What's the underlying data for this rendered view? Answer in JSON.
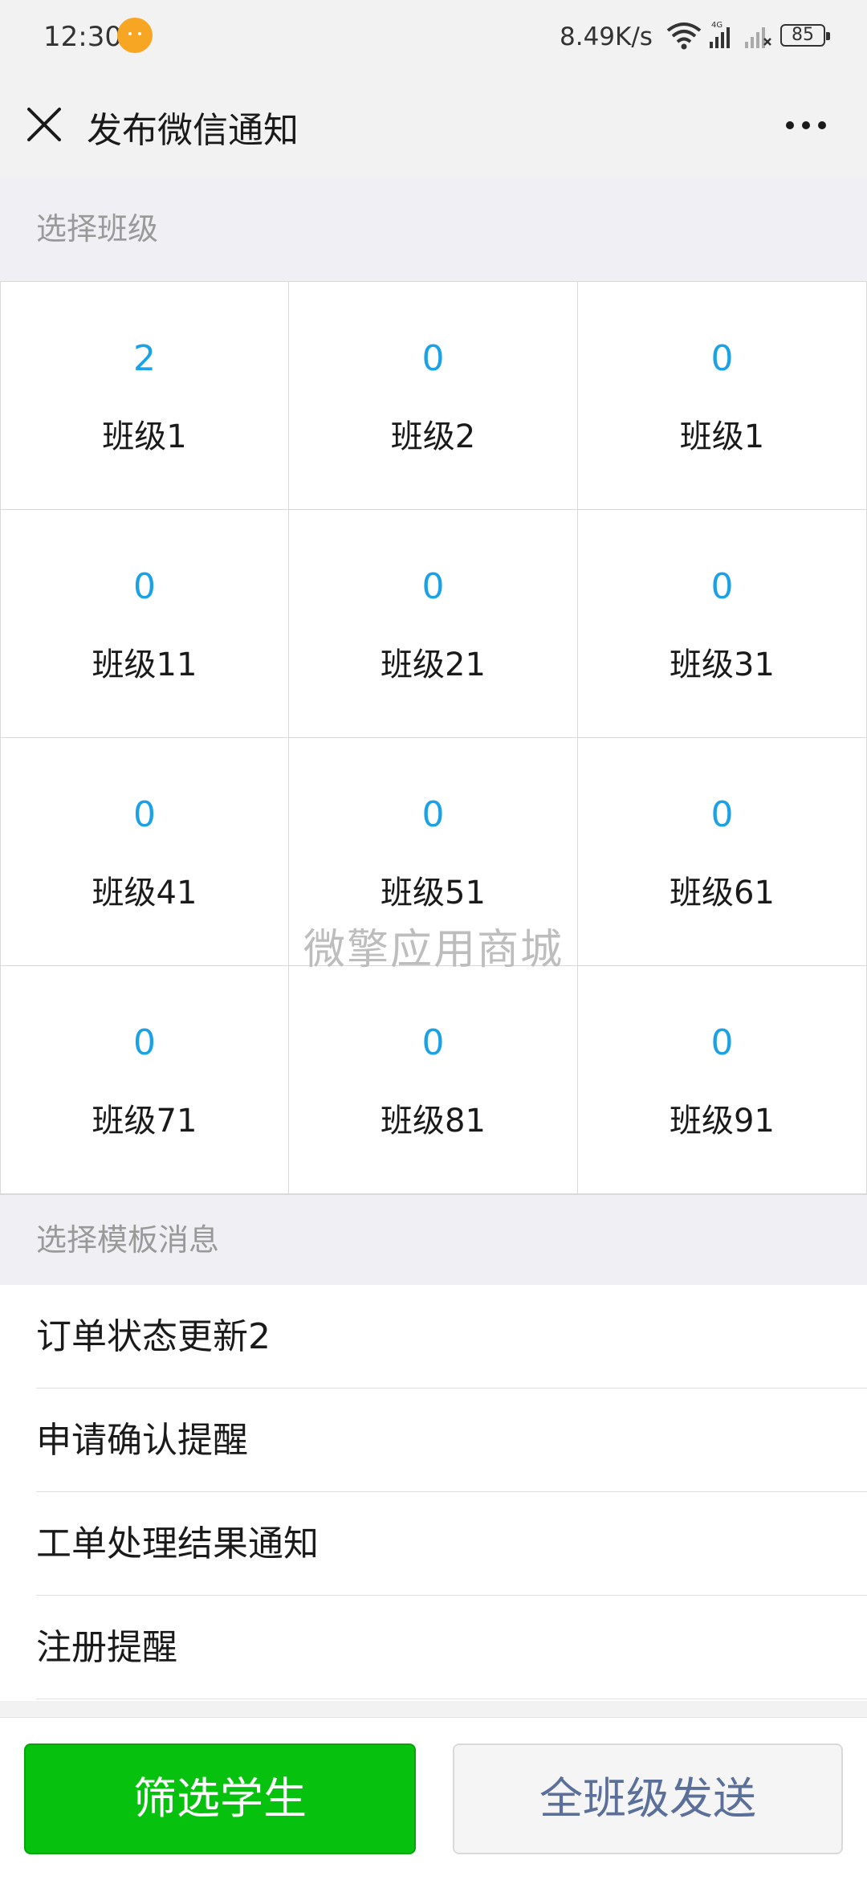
{
  "status_bar": {
    "time": "12:30",
    "network_speed": "8.49K/s",
    "network_type": "4G",
    "battery": "85",
    "icons": [
      "chat-bubble-icon",
      "wifi-icon",
      "signal-icon",
      "signal-no-service-icon",
      "battery-icon"
    ]
  },
  "header": {
    "title": "发布微信通知",
    "close_icon": "close-icon",
    "more_icon": "more-icon"
  },
  "classes_section": {
    "label": "选择班级",
    "items": [
      {
        "count": "2",
        "name": "班级1"
      },
      {
        "count": "0",
        "name": "班级2"
      },
      {
        "count": "0",
        "name": "班级1"
      },
      {
        "count": "0",
        "name": "班级11"
      },
      {
        "count": "0",
        "name": "班级21"
      },
      {
        "count": "0",
        "name": "班级31"
      },
      {
        "count": "0",
        "name": "班级41"
      },
      {
        "count": "0",
        "name": "班级51"
      },
      {
        "count": "0",
        "name": "班级61"
      },
      {
        "count": "0",
        "name": "班级71"
      },
      {
        "count": "0",
        "name": "班级81"
      },
      {
        "count": "0",
        "name": "班级91"
      }
    ]
  },
  "watermark": "微擎应用商城",
  "templates_section": {
    "label": "选择模板消息",
    "items": [
      "订单状态更新2",
      "申请确认提醒",
      "工单处理结果通知",
      "注册提醒"
    ]
  },
  "actions": {
    "filter_label": "筛选学生",
    "send_all_label": "全班级发送"
  },
  "colors": {
    "accent_blue": "#1aa1e6",
    "primary_green": "#07c10f",
    "secondary_text": "#5a6f9a"
  }
}
